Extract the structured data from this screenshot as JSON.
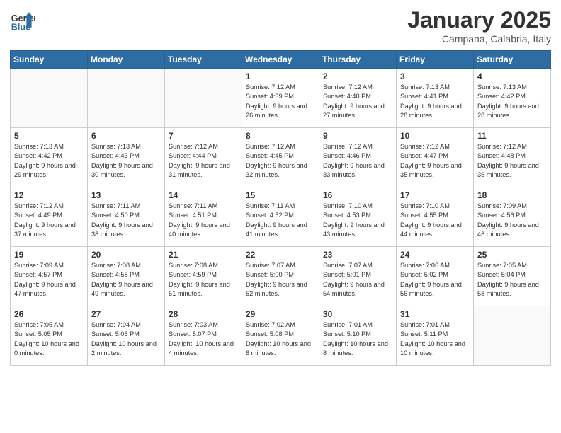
{
  "logo": {
    "general": "General",
    "blue": "Blue"
  },
  "header": {
    "month": "January 2025",
    "location": "Campana, Calabria, Italy"
  },
  "weekdays": [
    "Sunday",
    "Monday",
    "Tuesday",
    "Wednesday",
    "Thursday",
    "Friday",
    "Saturday"
  ],
  "weeks": [
    [
      {
        "day": "",
        "empty": true
      },
      {
        "day": "",
        "empty": true
      },
      {
        "day": "",
        "empty": true
      },
      {
        "day": "1",
        "sunrise": "7:12 AM",
        "sunset": "4:39 PM",
        "daylight": "9 hours and 26 minutes."
      },
      {
        "day": "2",
        "sunrise": "7:12 AM",
        "sunset": "4:40 PM",
        "daylight": "9 hours and 27 minutes."
      },
      {
        "day": "3",
        "sunrise": "7:13 AM",
        "sunset": "4:41 PM",
        "daylight": "9 hours and 28 minutes."
      },
      {
        "day": "4",
        "sunrise": "7:13 AM",
        "sunset": "4:42 PM",
        "daylight": "9 hours and 28 minutes."
      }
    ],
    [
      {
        "day": "5",
        "sunrise": "7:13 AM",
        "sunset": "4:42 PM",
        "daylight": "9 hours and 29 minutes."
      },
      {
        "day": "6",
        "sunrise": "7:13 AM",
        "sunset": "4:43 PM",
        "daylight": "9 hours and 30 minutes."
      },
      {
        "day": "7",
        "sunrise": "7:12 AM",
        "sunset": "4:44 PM",
        "daylight": "9 hours and 31 minutes."
      },
      {
        "day": "8",
        "sunrise": "7:12 AM",
        "sunset": "4:45 PM",
        "daylight": "9 hours and 32 minutes."
      },
      {
        "day": "9",
        "sunrise": "7:12 AM",
        "sunset": "4:46 PM",
        "daylight": "9 hours and 33 minutes."
      },
      {
        "day": "10",
        "sunrise": "7:12 AM",
        "sunset": "4:47 PM",
        "daylight": "9 hours and 35 minutes."
      },
      {
        "day": "11",
        "sunrise": "7:12 AM",
        "sunset": "4:48 PM",
        "daylight": "9 hours and 36 minutes."
      }
    ],
    [
      {
        "day": "12",
        "sunrise": "7:12 AM",
        "sunset": "4:49 PM",
        "daylight": "9 hours and 37 minutes."
      },
      {
        "day": "13",
        "sunrise": "7:11 AM",
        "sunset": "4:50 PM",
        "daylight": "9 hours and 38 minutes."
      },
      {
        "day": "14",
        "sunrise": "7:11 AM",
        "sunset": "4:51 PM",
        "daylight": "9 hours and 40 minutes."
      },
      {
        "day": "15",
        "sunrise": "7:11 AM",
        "sunset": "4:52 PM",
        "daylight": "9 hours and 41 minutes."
      },
      {
        "day": "16",
        "sunrise": "7:10 AM",
        "sunset": "4:53 PM",
        "daylight": "9 hours and 43 minutes."
      },
      {
        "day": "17",
        "sunrise": "7:10 AM",
        "sunset": "4:55 PM",
        "daylight": "9 hours and 44 minutes."
      },
      {
        "day": "18",
        "sunrise": "7:09 AM",
        "sunset": "4:56 PM",
        "daylight": "9 hours and 46 minutes."
      }
    ],
    [
      {
        "day": "19",
        "sunrise": "7:09 AM",
        "sunset": "4:57 PM",
        "daylight": "9 hours and 47 minutes."
      },
      {
        "day": "20",
        "sunrise": "7:08 AM",
        "sunset": "4:58 PM",
        "daylight": "9 hours and 49 minutes."
      },
      {
        "day": "21",
        "sunrise": "7:08 AM",
        "sunset": "4:59 PM",
        "daylight": "9 hours and 51 minutes."
      },
      {
        "day": "22",
        "sunrise": "7:07 AM",
        "sunset": "5:00 PM",
        "daylight": "9 hours and 52 minutes."
      },
      {
        "day": "23",
        "sunrise": "7:07 AM",
        "sunset": "5:01 PM",
        "daylight": "9 hours and 54 minutes."
      },
      {
        "day": "24",
        "sunrise": "7:06 AM",
        "sunset": "5:02 PM",
        "daylight": "9 hours and 56 minutes."
      },
      {
        "day": "25",
        "sunrise": "7:05 AM",
        "sunset": "5:04 PM",
        "daylight": "9 hours and 58 minutes."
      }
    ],
    [
      {
        "day": "26",
        "sunrise": "7:05 AM",
        "sunset": "5:05 PM",
        "daylight": "10 hours and 0 minutes."
      },
      {
        "day": "27",
        "sunrise": "7:04 AM",
        "sunset": "5:06 PM",
        "daylight": "10 hours and 2 minutes."
      },
      {
        "day": "28",
        "sunrise": "7:03 AM",
        "sunset": "5:07 PM",
        "daylight": "10 hours and 4 minutes."
      },
      {
        "day": "29",
        "sunrise": "7:02 AM",
        "sunset": "5:08 PM",
        "daylight": "10 hours and 6 minutes."
      },
      {
        "day": "30",
        "sunrise": "7:01 AM",
        "sunset": "5:10 PM",
        "daylight": "10 hours and 8 minutes."
      },
      {
        "day": "31",
        "sunrise": "7:01 AM",
        "sunset": "5:11 PM",
        "daylight": "10 hours and 10 minutes."
      },
      {
        "day": "",
        "empty": true
      }
    ]
  ]
}
